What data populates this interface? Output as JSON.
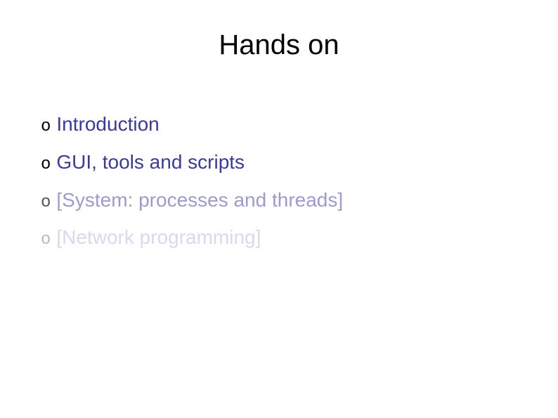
{
  "slide": {
    "title": "Hands on",
    "bullet": "o",
    "items": [
      {
        "label": "Introduction"
      },
      {
        "label": "GUI, tools and scripts"
      },
      {
        "label": "[System: processes and threads]"
      },
      {
        "label": "[Network programming]"
      }
    ]
  }
}
